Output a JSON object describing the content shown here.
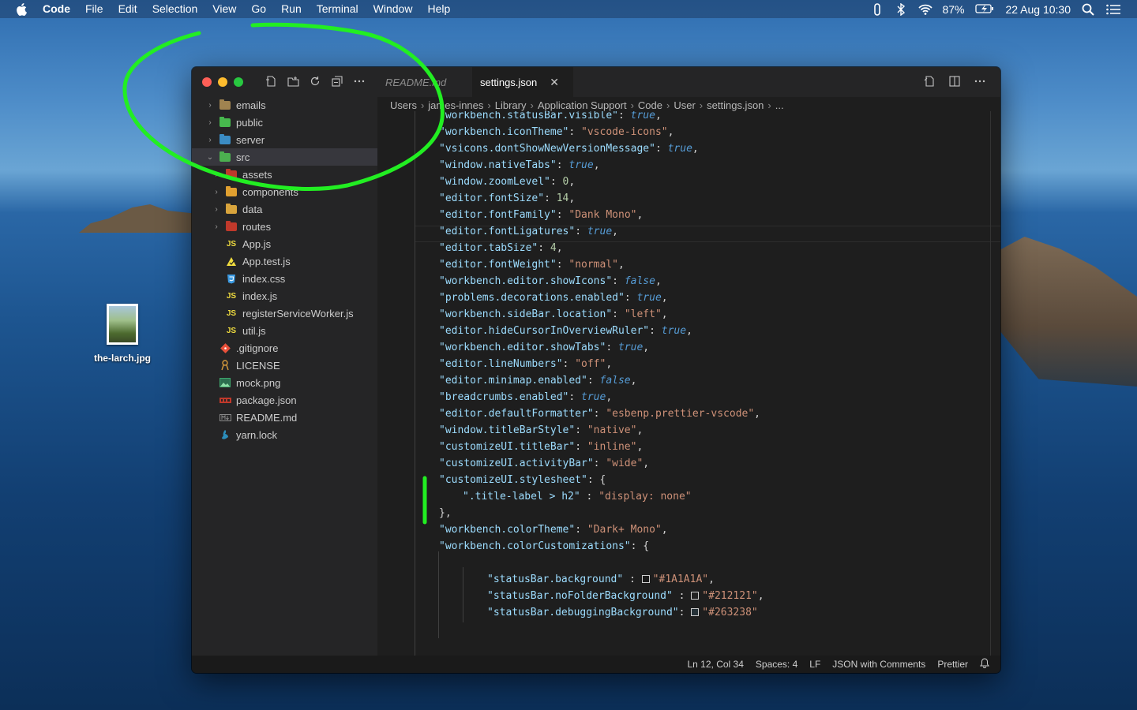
{
  "menubar": {
    "items": [
      "Code",
      "File",
      "Edit",
      "Selection",
      "View",
      "Go",
      "Run",
      "Terminal",
      "Window",
      "Help"
    ],
    "battery": "87%",
    "datetime": "22 Aug  10:30"
  },
  "desktop": {
    "icon_label": "the-larch.jpg"
  },
  "explorer": {
    "items": [
      {
        "label": "emails",
        "icon": "folder-icon",
        "color": "#a08350"
      },
      {
        "label": "public",
        "icon": "folder-public-icon",
        "color": "#47b94e"
      },
      {
        "label": "server",
        "icon": "folder-server-icon",
        "color": "#3b8cc4"
      },
      {
        "label": "src",
        "icon": "folder-src-icon",
        "color": "#4caf50"
      },
      {
        "label": "assets",
        "icon": "folder-assets-icon",
        "color": "#c0392b"
      },
      {
        "label": "components",
        "icon": "folder-components-icon",
        "color": "#e0a030"
      },
      {
        "label": "data",
        "icon": "folder-data-icon",
        "color": "#d8a43c"
      },
      {
        "label": "routes",
        "icon": "folder-routes-icon",
        "color": "#c0392b"
      },
      {
        "label": "App.js",
        "icon": "js-icon",
        "color": "#f1dd3f"
      },
      {
        "label": "App.test.js",
        "icon": "test-js-icon",
        "color": "#f1dd3f"
      },
      {
        "label": "index.css",
        "icon": "css-icon",
        "color": "#3b9ae1"
      },
      {
        "label": "index.js",
        "icon": "js-icon",
        "color": "#f1dd3f"
      },
      {
        "label": "registerServiceWorker.js",
        "icon": "js-icon",
        "color": "#f1dd3f"
      },
      {
        "label": "util.js",
        "icon": "js-icon",
        "color": "#f1dd3f"
      },
      {
        "label": ".gitignore",
        "icon": "git-icon",
        "color": "#e8503a"
      },
      {
        "label": "LICENSE",
        "icon": "license-icon",
        "color": "#d89b3c"
      },
      {
        "label": "mock.png",
        "icon": "image-icon",
        "color": "#3ea56c"
      },
      {
        "label": "package.json",
        "icon": "npm-icon",
        "color": "#c0392b"
      },
      {
        "label": "README.md",
        "icon": "markdown-icon",
        "color": "#888888"
      },
      {
        "label": "yarn.lock",
        "icon": "yarn-icon",
        "color": "#2c8ebb"
      }
    ]
  },
  "tabs": [
    {
      "label": "README.md",
      "active": false
    },
    {
      "label": "settings.json",
      "active": true
    }
  ],
  "breadcrumbs": [
    "Users",
    "james-innes",
    "Library",
    "Application Support",
    "Code",
    "User",
    "settings.json",
    "..."
  ],
  "code_lines": [
    [
      [
        "k",
        "\"workbench.statusBar.visible\""
      ],
      [
        "p",
        ": "
      ],
      [
        "b",
        "true"
      ],
      [
        "p",
        ","
      ]
    ],
    [
      [
        "k",
        "\"workbench.iconTheme\""
      ],
      [
        "p",
        ": "
      ],
      [
        "s",
        "\"vscode-icons\""
      ],
      [
        "p",
        ","
      ]
    ],
    [
      [
        "k",
        "\"vsicons.dontShowNewVersionMessage\""
      ],
      [
        "p",
        ": "
      ],
      [
        "b",
        "true"
      ],
      [
        "p",
        ","
      ]
    ],
    [
      [
        "k",
        "\"window.nativeTabs\""
      ],
      [
        "p",
        ": "
      ],
      [
        "b",
        "true"
      ],
      [
        "p",
        ","
      ]
    ],
    [
      [
        "k",
        "\"window.zoomLevel\""
      ],
      [
        "p",
        ": "
      ],
      [
        "n",
        "0"
      ],
      [
        "p",
        ","
      ]
    ],
    [
      [
        "k",
        "\"editor.fontSize\""
      ],
      [
        "p",
        ": "
      ],
      [
        "n",
        "14"
      ],
      [
        "p",
        ","
      ]
    ],
    [
      [
        "k",
        "\"editor.fontFamily\""
      ],
      [
        "p",
        ": "
      ],
      [
        "s",
        "\"Dank Mono\""
      ],
      [
        "p",
        ","
      ]
    ],
    [
      [
        "k",
        "\"editor.fontLigatures\""
      ],
      [
        "p",
        ": "
      ],
      [
        "b",
        "true"
      ],
      [
        "p",
        ","
      ]
    ],
    [
      [
        "k",
        "\"editor.tabSize\""
      ],
      [
        "p",
        ": "
      ],
      [
        "n",
        "4"
      ],
      [
        "p",
        ","
      ]
    ],
    [
      [
        "k",
        "\"editor.fontWeight\""
      ],
      [
        "p",
        ": "
      ],
      [
        "s",
        "\"normal\""
      ],
      [
        "p",
        ","
      ]
    ],
    [
      [
        "k",
        "\"workbench.editor.showIcons\""
      ],
      [
        "p",
        ": "
      ],
      [
        "b",
        "false"
      ],
      [
        "p",
        ","
      ]
    ],
    [
      [
        "k",
        "\"problems.decorations.enabled\""
      ],
      [
        "p",
        ": "
      ],
      [
        "b",
        "true"
      ],
      [
        "p",
        ","
      ]
    ],
    [
      [
        "k",
        "\"workbench.sideBar.location\""
      ],
      [
        "p",
        ": "
      ],
      [
        "s",
        "\"left\""
      ],
      [
        "p",
        ","
      ]
    ],
    [
      [
        "k",
        "\"editor.hideCursorInOverviewRuler\""
      ],
      [
        "p",
        ": "
      ],
      [
        "b",
        "true"
      ],
      [
        "p",
        ","
      ]
    ],
    [
      [
        "k",
        "\"workbench.editor.showTabs\""
      ],
      [
        "p",
        ": "
      ],
      [
        "b",
        "true"
      ],
      [
        "p",
        ","
      ]
    ],
    [
      [
        "k",
        "\"editor.lineNumbers\""
      ],
      [
        "p",
        ": "
      ],
      [
        "s",
        "\"off\""
      ],
      [
        "p",
        ","
      ]
    ],
    [
      [
        "k",
        "\"editor.minimap.enabled\""
      ],
      [
        "p",
        ": "
      ],
      [
        "b",
        "false"
      ],
      [
        "p",
        ","
      ]
    ],
    [
      [
        "k",
        "\"breadcrumbs.enabled\""
      ],
      [
        "p",
        ": "
      ],
      [
        "b",
        "true"
      ],
      [
        "p",
        ","
      ]
    ],
    [
      [
        "k",
        "\"editor.defaultFormatter\""
      ],
      [
        "p",
        ": "
      ],
      [
        "s",
        "\"esbenp.prettier-vscode\""
      ],
      [
        "p",
        ","
      ]
    ],
    [
      [
        "k",
        "\"window.titleBarStyle\""
      ],
      [
        "p",
        ": "
      ],
      [
        "s",
        "\"native\""
      ],
      [
        "p",
        ","
      ]
    ],
    [
      [
        "k",
        "\"customizeUI.titleBar\""
      ],
      [
        "p",
        ": "
      ],
      [
        "s",
        "\"inline\""
      ],
      [
        "p",
        ","
      ]
    ],
    [
      [
        "k",
        "\"customizeUI.activityBar\""
      ],
      [
        "p",
        ": "
      ],
      [
        "s",
        "\"wide\""
      ],
      [
        "p",
        ","
      ]
    ],
    [
      [
        "k",
        "\"customizeUI.stylesheet\""
      ],
      [
        "p",
        ": {"
      ]
    ],
    [
      [
        "k",
        "\".title-label > h2\""
      ],
      [
        "p",
        " : "
      ],
      [
        "s",
        "\"display: none\""
      ]
    ],
    [
      [
        "p",
        "},"
      ]
    ],
    [
      [
        "k",
        "\"workbench.colorTheme\""
      ],
      [
        "p",
        ": "
      ],
      [
        "s",
        "\"Dark+ Mono\""
      ],
      [
        "p",
        ","
      ]
    ],
    [
      [
        "k",
        "\"workbench.colorCustomizations\""
      ],
      [
        "p",
        ": {"
      ]
    ],
    [],
    [
      [
        "k",
        "\"statusBar.background\""
      ],
      [
        "p",
        " : "
      ],
      [
        "sw",
        "#1A1A1A"
      ],
      [
        "s",
        "\"#1A1A1A\""
      ],
      [
        "p",
        ","
      ]
    ],
    [
      [
        "k",
        "\"statusBar.noFolderBackground\""
      ],
      [
        "p",
        " : "
      ],
      [
        "sw",
        "#212121"
      ],
      [
        "s",
        "\"#212121\""
      ],
      [
        "p",
        ","
      ]
    ],
    [
      [
        "k",
        "\"statusBar.debuggingBackground\""
      ],
      [
        "p",
        ": "
      ],
      [
        "sw",
        "#263238"
      ],
      [
        "s",
        "\"#263238\""
      ]
    ],
    [],
    [],
    [
      [
        "p",
        "},"
      ]
    ]
  ],
  "statusbar": {
    "position": "Ln 12, Col 34",
    "spaces": "Spaces: 4",
    "eol": "LF",
    "language": "JSON with Comments",
    "formatter": "Prettier"
  },
  "colors": {
    "annotation": "#22ee22",
    "editor_bg": "#1e1e1e",
    "sidebar_bg": "#252526"
  }
}
